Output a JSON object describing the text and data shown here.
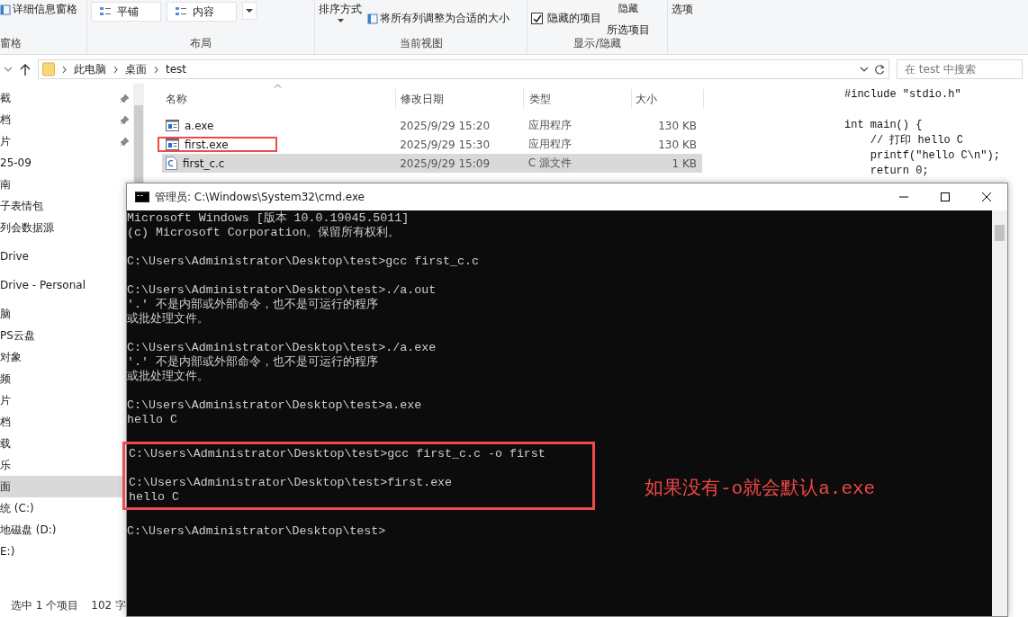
{
  "ribbon": {
    "groups": [
      {
        "label": "窗格",
        "items": [
          {
            "kind": "button",
            "text": "详细信息窗格"
          }
        ]
      },
      {
        "label": "布局",
        "items": [
          {
            "kind": "gallery",
            "text": "平铺"
          },
          {
            "kind": "gallery",
            "text": "内容"
          }
        ]
      },
      {
        "label": "当前视图",
        "items": [
          {
            "kind": "menu",
            "text": "排序方式"
          },
          {
            "kind": "button",
            "text": "将所有列调整为合适的大小"
          }
        ]
      },
      {
        "label": "显示/隐藏",
        "items": [
          {
            "kind": "checkbox",
            "text": "隐藏的项目",
            "checked": true
          },
          {
            "kind": "stack",
            "text": "隐藏",
            "sub": "所选项目"
          }
        ]
      },
      {
        "items": [
          {
            "kind": "plain",
            "text": "选项"
          }
        ]
      }
    ]
  },
  "address": {
    "path": [
      "此电脑",
      "桌面",
      "test"
    ],
    "search_placeholder": "在 test 中搜索"
  },
  "nav": {
    "groups": [
      [
        {
          "label": "截",
          "pinned": true
        },
        {
          "label": "档",
          "pinned": true
        },
        {
          "label": "片",
          "pinned": true
        },
        {
          "label": "25-09",
          "pinned": false
        },
        {
          "label": "南",
          "pinned": false
        },
        {
          "label": "子表情包",
          "pinned": false
        },
        {
          "label": "列会数据源",
          "pinned": false
        }
      ],
      [
        {
          "label": "Drive",
          "pinned": false
        }
      ],
      [
        {
          "label": "Drive - Personal",
          "pinned": false
        }
      ],
      [
        {
          "label": "脑",
          "pinned": false,
          "selected": false
        },
        {
          "label": "PS云盘",
          "pinned": false,
          "selected": false
        },
        {
          "label": "对象",
          "pinned": false,
          "selected": false
        },
        {
          "label": "频",
          "pinned": false,
          "selected": false
        },
        {
          "label": "片",
          "pinned": false,
          "selected": false
        },
        {
          "label": "档",
          "pinned": false,
          "selected": false
        },
        {
          "label": "载",
          "pinned": false,
          "selected": false
        },
        {
          "label": "乐",
          "pinned": false,
          "selected": false
        },
        {
          "label": "面",
          "pinned": false,
          "selected": true
        },
        {
          "label": "统 (C:)",
          "pinned": false,
          "selected": false
        },
        {
          "label": "地磁盘 (D:)",
          "pinned": false,
          "selected": false
        },
        {
          "label": "E:)",
          "pinned": false,
          "selected": false
        }
      ]
    ]
  },
  "files": {
    "columns": [
      "名称",
      "修改日期",
      "类型",
      "大小"
    ],
    "rows": [
      {
        "kind": "exe",
        "name": "a.exe",
        "date": "2025/9/29 15:20",
        "type": "应用程序",
        "size": "130 KB",
        "selected": false,
        "highlighted": false
      },
      {
        "kind": "exe",
        "name": "first.exe",
        "date": "2025/9/29 15:30",
        "type": "应用程序",
        "size": "130 KB",
        "selected": false,
        "highlighted": true
      },
      {
        "kind": "c",
        "name": "first_c.c",
        "date": "2025/9/29 15:09",
        "type": "C 源文件",
        "size": "1 KB",
        "selected": true,
        "highlighted": false
      }
    ]
  },
  "preview": {
    "code": "#include \"stdio.h\"\n\nint main() {\n    // 打印 hello C\n    printf(\"hello C\\n\");\n    return 0;"
  },
  "status_bar": {
    "selection": "选中 1 个项目",
    "size": "102 字"
  },
  "cmd": {
    "title": "管理员: C:\\Windows\\System32\\cmd.exe",
    "blocks": [
      {
        "highlighted": false,
        "lines": [
          "Microsoft Windows [版本 10.0.19045.5011]",
          "(c) Microsoft Corporation。保留所有权利。"
        ]
      },
      {
        "highlighted": false,
        "lines": [
          "C:\\Users\\Administrator\\Desktop\\test>gcc first_c.c"
        ]
      },
      {
        "highlighted": false,
        "lines": [
          "C:\\Users\\Administrator\\Desktop\\test>./a.out",
          "'.' 不是内部或外部命令，也不是可运行的程序",
          "或批处理文件。"
        ]
      },
      {
        "highlighted": false,
        "lines": [
          "C:\\Users\\Administrator\\Desktop\\test>./a.exe",
          "'.' 不是内部或外部命令，也不是可运行的程序",
          "或批处理文件。"
        ]
      },
      {
        "highlighted": false,
        "lines": [
          "C:\\Users\\Administrator\\Desktop\\test>a.exe",
          "hello C"
        ]
      },
      {
        "highlighted": true,
        "lines": [
          "C:\\Users\\Administrator\\Desktop\\test>gcc first_c.c -o first"
        ]
      },
      {
        "highlighted": true,
        "lines": [
          "C:\\Users\\Administrator\\Desktop\\test>first.exe",
          "hello C"
        ]
      },
      {
        "highlighted": false,
        "lines": [
          "C:\\Users\\Administrator\\Desktop\\test>"
        ]
      }
    ],
    "note": "如果没有-o就会默认a.exe"
  }
}
